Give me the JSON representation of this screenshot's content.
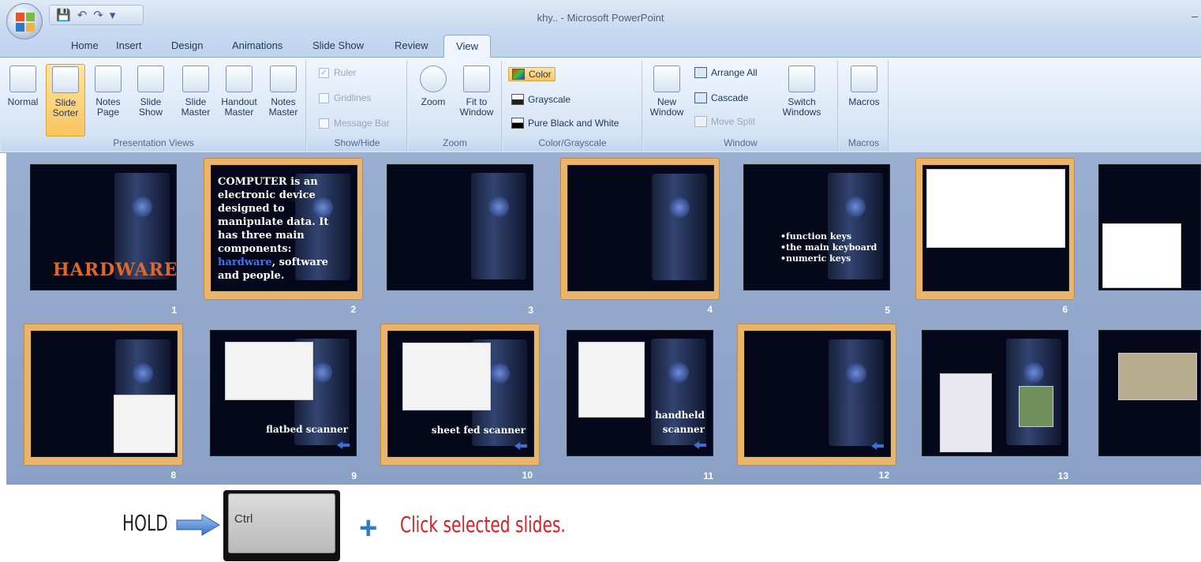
{
  "window": {
    "title": "khy.. - Microsoft PowerPoint"
  },
  "tabs": [
    "Home",
    "Insert",
    "Design",
    "Animations",
    "Slide Show",
    "Review",
    "View"
  ],
  "active_tab": "View",
  "ribbon": {
    "presentation_views": {
      "label": "Presentation Views",
      "buttons": [
        {
          "l1": "Normal",
          "l2": ""
        },
        {
          "l1": "Slide",
          "l2": "Sorter"
        },
        {
          "l1": "Notes",
          "l2": "Page"
        },
        {
          "l1": "Slide",
          "l2": "Show"
        },
        {
          "l1": "Slide",
          "l2": "Master"
        },
        {
          "l1": "Handout",
          "l2": "Master"
        },
        {
          "l1": "Notes",
          "l2": "Master"
        }
      ]
    },
    "show_hide": {
      "label": "Show/Hide",
      "ruler": "Ruler",
      "gridlines": "Gridlines",
      "message_bar": "Message Bar"
    },
    "zoom": {
      "label": "Zoom",
      "zoom": "Zoom",
      "fit1": "Fit to",
      "fit2": "Window"
    },
    "color_grayscale": {
      "label": "Color/Grayscale",
      "color": "Color",
      "grayscale": "Grayscale",
      "pure": "Pure Black and White"
    },
    "window": {
      "label": "Window",
      "new1": "New",
      "new2": "Window",
      "arrange_all": "Arrange All",
      "cascade": "Cascade",
      "move_split": "Move Split",
      "switch1": "Switch",
      "switch2": "Windows"
    },
    "macros": {
      "label": "Macros",
      "button": "Macros"
    }
  },
  "slides": [
    {
      "n": "1",
      "hardware": "HARDWARE"
    },
    {
      "n": "2",
      "t1": "COMPUTER",
      "t2": " is an electronic device designed to manipulate data. It has three main components: ",
      "t3": "hardware",
      "t4": ", software and people."
    },
    {
      "n": "3"
    },
    {
      "n": "4"
    },
    {
      "n": "5",
      "keys": [
        "•function keys",
        "•the main keyboard",
        "•numeric keys"
      ]
    },
    {
      "n": "6"
    },
    {
      "n": "8"
    },
    {
      "n": "9",
      "caption": "flatbed scanner"
    },
    {
      "n": "10",
      "caption": "sheet fed scanner"
    },
    {
      "n": "11",
      "c1": "handheld",
      "c2": "scanner"
    },
    {
      "n": "12"
    },
    {
      "n": "13"
    }
  ],
  "instruction": {
    "hold": "HOLD",
    "key": "Ctrl",
    "text": "Click selected slides."
  },
  "colors": {
    "accent_red": "#d82027",
    "accent_blue": "#2f79c8",
    "selection": "#e9b56c"
  }
}
